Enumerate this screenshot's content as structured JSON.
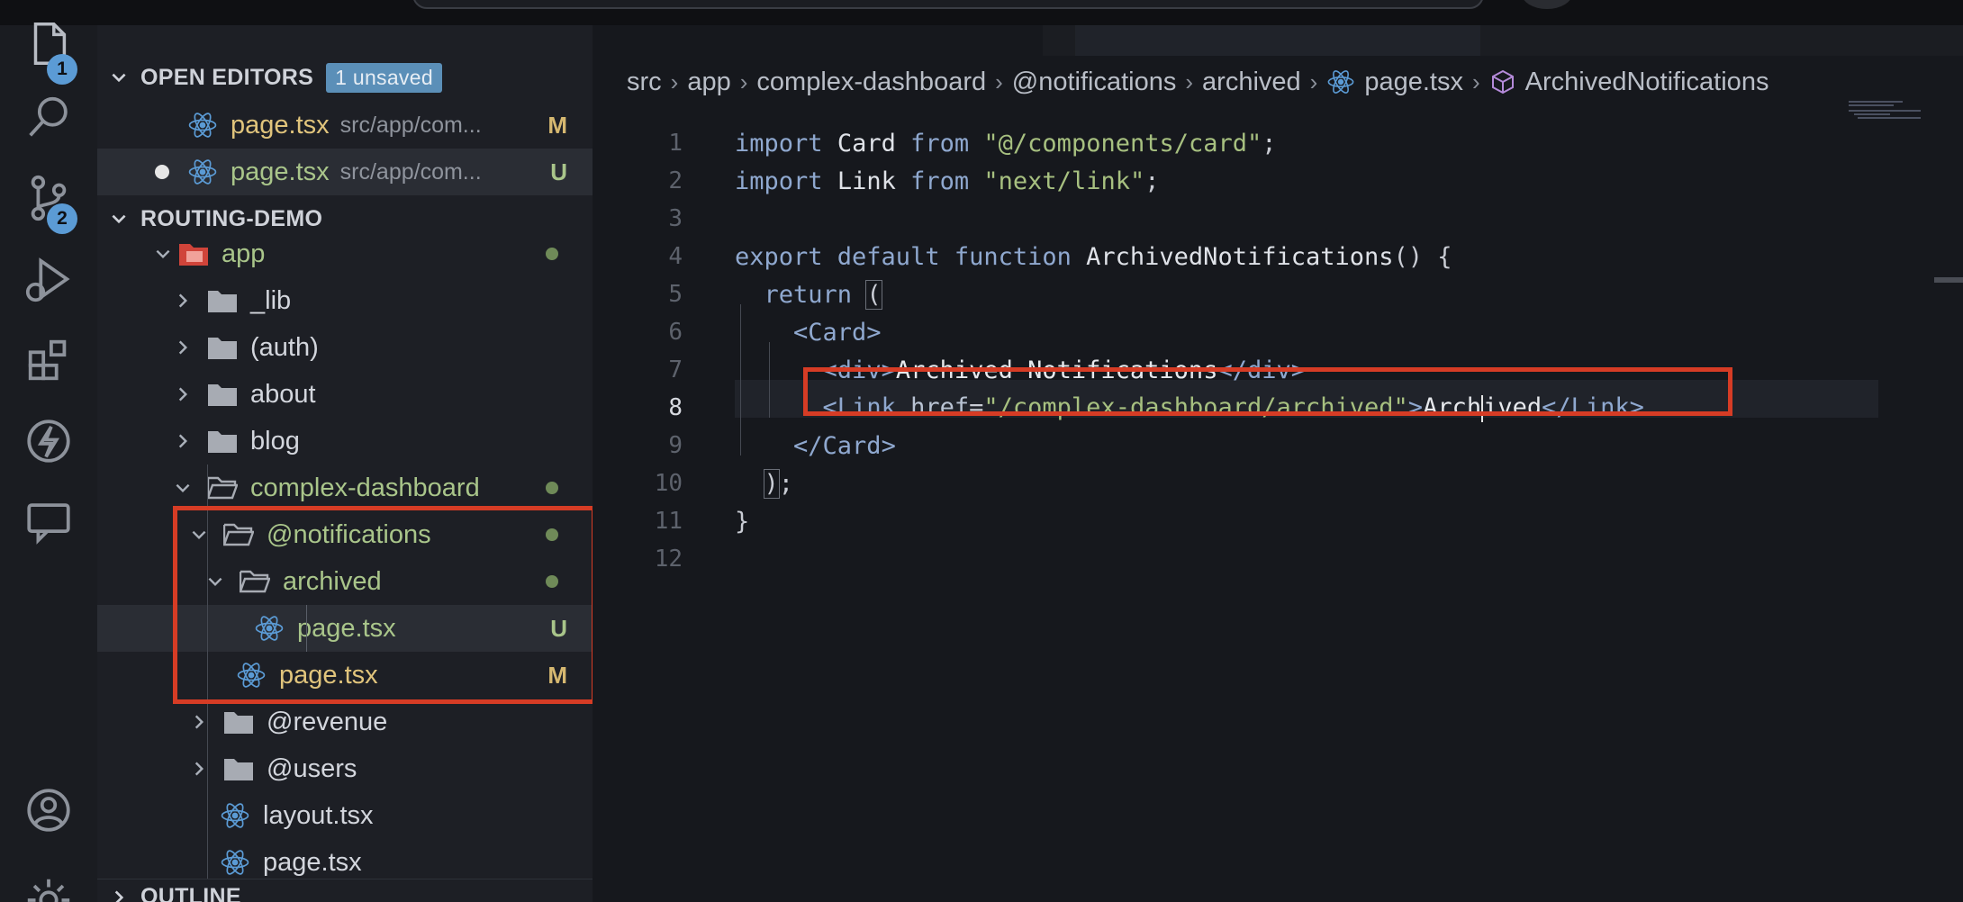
{
  "explorer": {
    "open_editors": {
      "title": "OPEN EDITORS",
      "badge": "1 unsaved",
      "files": [
        {
          "name": "page.tsx",
          "path": "src/app/com...",
          "status": "M"
        },
        {
          "name": "page.tsx",
          "path": "src/app/com...",
          "status": "U"
        }
      ]
    },
    "project": {
      "title": "ROUTING-DEMO",
      "tree": [
        {
          "name": "app"
        },
        {
          "name": "_lib"
        },
        {
          "name": "(auth)"
        },
        {
          "name": "about"
        },
        {
          "name": "blog"
        },
        {
          "name": "complex-dashboard"
        },
        {
          "name": "@notifications"
        },
        {
          "name": "archived"
        },
        {
          "name": "page.tsx",
          "status": "U"
        },
        {
          "name": "page.tsx",
          "status": "M"
        },
        {
          "name": "@revenue"
        },
        {
          "name": "@users"
        },
        {
          "name": "layout.tsx"
        },
        {
          "name": "page.tsx"
        }
      ]
    },
    "outline_title": "OUTLINE"
  },
  "activity_badges": {
    "explorer": "1",
    "source_control": "2"
  },
  "breadcrumb": [
    "src",
    "app",
    "complex-dashboard",
    "@notifications",
    "archived",
    "page.tsx",
    "ArchivedNotifications"
  ],
  "code": {
    "line_numbers": [
      "1",
      "2",
      "3",
      "4",
      "5",
      "6",
      "7",
      "8",
      "9",
      "10",
      "11",
      "12"
    ],
    "lines": [
      "import Card from \"@/components/card\";",
      "import Link from \"next/link\";",
      "",
      "export default function ArchivedNotifications() {",
      "  return (",
      "    <Card>",
      "      <div>Archived Notifications</div>",
      "      <Link href=\"/complex-dashboard/archived\">Archived</Link>",
      "    </Card>",
      "  );",
      "}",
      ""
    ],
    "current_line": 8
  },
  "colors": {
    "highlight_box": "#d63c25",
    "badge": "#5b9bd5",
    "modified": "#e0c47c",
    "untracked": "#a9c58a"
  },
  "icons": {
    "activity": [
      "files-icon",
      "search-icon",
      "source-control-icon",
      "run-debug-icon",
      "extensions-icon",
      "bolt-icon",
      "remote-chat-icon",
      "account-icon",
      "settings-icon"
    ],
    "file": "react-icon",
    "folder": "folder-icon"
  }
}
